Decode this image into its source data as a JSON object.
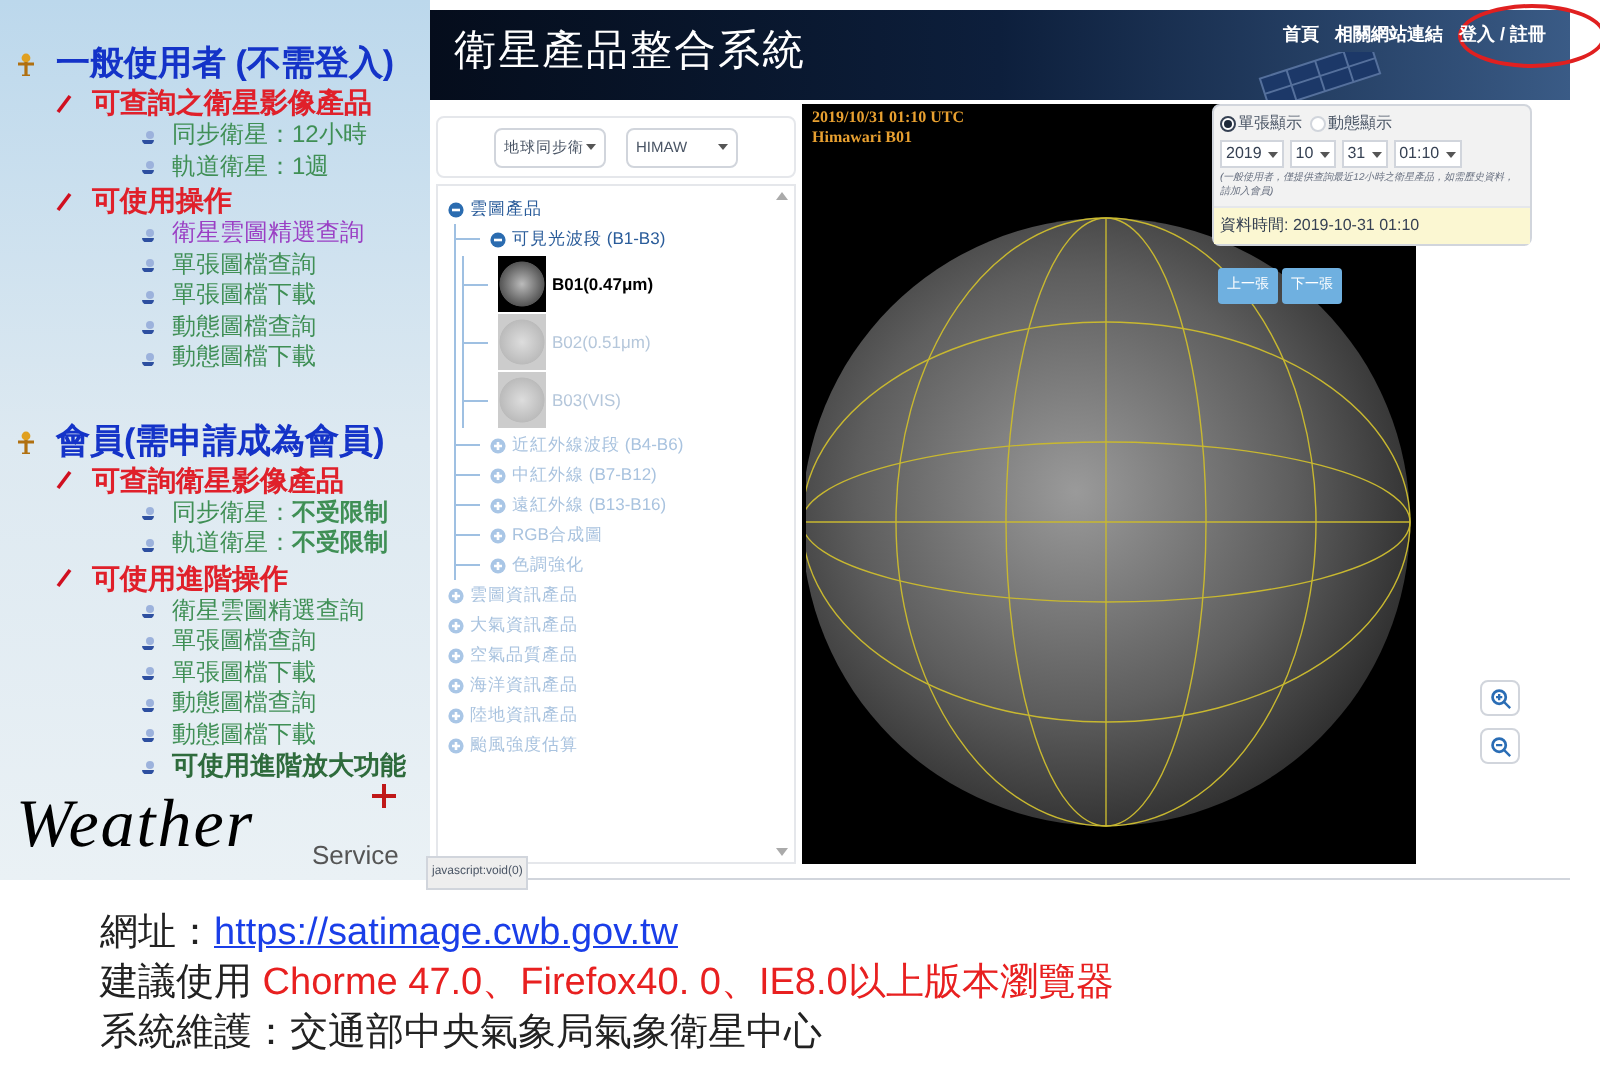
{
  "intro_panel": {
    "groups": [
      {
        "title": "一般使用者 (不需登入)",
        "sections": [
          {
            "title": "可查詢之衛星影像產品",
            "items": [
              {
                "text": "同步衛星：12小時",
                "color": "#3f8f55",
                "strong": false
              },
              {
                "text": "軌道衛星：1週",
                "color": "#3f8f55",
                "strong": false
              }
            ]
          },
          {
            "title": "可使用操作",
            "items": [
              {
                "text": "衛星雲圖精選查詢",
                "color": "#9a3fc4",
                "strong": false
              },
              {
                "text": "單張圖檔查詢",
                "color": "#3f8f55",
                "strong": false
              },
              {
                "text": "單張圖檔下載",
                "color": "#3f8f55",
                "strong": false
              },
              {
                "text": "動態圖檔查詢",
                "color": "#3f8f55",
                "strong": false
              },
              {
                "text": "動態圖檔下載",
                "color": "#3f8f55",
                "strong": false
              }
            ]
          }
        ]
      },
      {
        "title": "會員(需申請成為會員)",
        "sections": [
          {
            "title": "可查詢衛星影像產品",
            "items": [
              {
                "text": "同步衛星：**不受限制**",
                "color": "#3f8f55",
                "strong": false
              },
              {
                "text": "軌道衛星：**不受限制**",
                "color": "#3f8f55",
                "strong": false
              }
            ]
          },
          {
            "title": "可使用進階操作",
            "items": [
              {
                "text": "衛星雲圖精選查詢",
                "color": "#3f8f55",
                "strong": false
              },
              {
                "text": "單張圖檔查詢",
                "color": "#3f8f55",
                "strong": false
              },
              {
                "text": "單張圖檔下載",
                "color": "#3f8f55",
                "strong": false
              },
              {
                "text": "動態圖檔查詢",
                "color": "#3f8f55",
                "strong": false
              },
              {
                "text": "動態圖檔下載",
                "color": "#3f8f55",
                "strong": false
              },
              {
                "text": "可使用進階放大功能",
                "color": "#2e6b3c",
                "strong": true
              }
            ]
          }
        ]
      }
    ]
  },
  "logo": {
    "word": "Weather",
    "sub": "Service"
  },
  "app": {
    "title": "衛星產品整合系統",
    "nav": [
      "首頁",
      "相關網站連結",
      "登入 / 註冊"
    ],
    "selects": [
      "地球同步衛",
      "HIMAW"
    ],
    "tree": [
      {
        "label": "雲圖產品",
        "expanded": true,
        "children": [
          {
            "label": "可見光波段 (B1-B3)",
            "expanded": true,
            "children": [
              {
                "label": "B01(0.47μm)",
                "selected": true
              },
              {
                "label": "B02(0.51μm)",
                "selected": false
              },
              {
                "label": "B03(VIS)",
                "selected": false
              }
            ]
          },
          {
            "label": "近紅外線波段 (B4-B6)",
            "expanded": false
          },
          {
            "label": "中紅外線 (B7-B12)",
            "expanded": false
          },
          {
            "label": "遠紅外線 (B13-B16)",
            "expanded": false
          },
          {
            "label": "RGB合成圖",
            "expanded": false
          },
          {
            "label": "色調強化",
            "expanded": false
          }
        ]
      },
      {
        "label": "雲圖資訊產品",
        "expanded": false
      },
      {
        "label": "大氣資訊產品",
        "expanded": false
      },
      {
        "label": "空氣品質產品",
        "expanded": false
      },
      {
        "label": "海洋資訊產品",
        "expanded": false
      },
      {
        "label": "陸地資訊產品",
        "expanded": false
      },
      {
        "label": "颱風強度估算",
        "expanded": false
      }
    ],
    "image_caption": [
      "2019/10/31 01:10 UTC",
      "Himawari B01"
    ],
    "display_modes": [
      {
        "label": "單張顯示",
        "selected": true
      },
      {
        "label": "動態顯示",
        "selected": false
      }
    ],
    "time_selects": [
      "2019",
      "10",
      "31",
      "01:10"
    ],
    "note": "(一般使用者，僅提供查詢最近12小時之衛星產品，如需歷史資料，請加入會員)",
    "data_time": "資料時間: 2019-10-31 01:10",
    "buttons": [
      "上一張",
      "下一張"
    ],
    "status_text": "javascript:void(0)"
  },
  "footer": {
    "lines": [
      {
        "label": "網址：",
        "link": "https://satimage.cwb.gov.tw"
      },
      {
        "label": "建議使用 ",
        "highlight": "Chorme 47.0、Firefox40. 0、IE8.0以上版本瀏覽器"
      },
      {
        "label": "系統維護：交通部中央氣象局氣象衛星中心"
      }
    ]
  }
}
